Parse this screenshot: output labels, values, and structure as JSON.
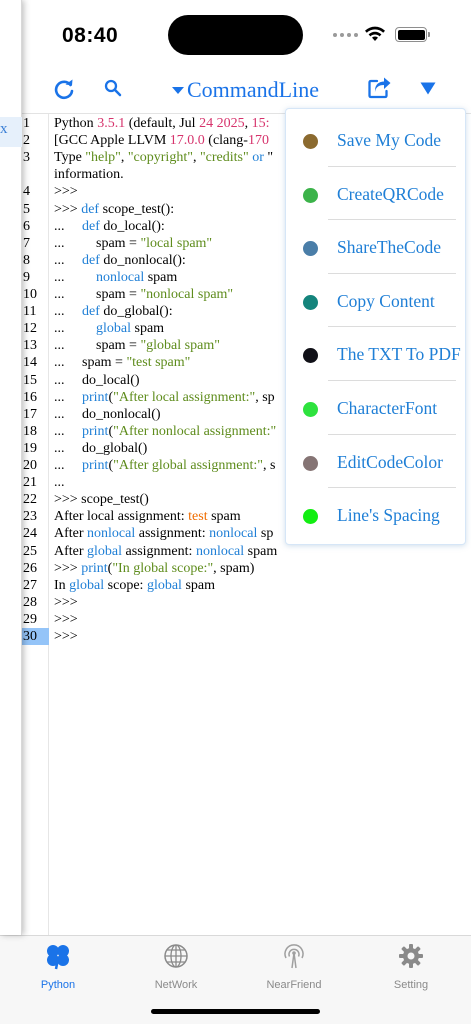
{
  "status": {
    "time": "08:40"
  },
  "side": {
    "cell_text": "x"
  },
  "toolbar": {
    "title": "CommandLine",
    "icons": [
      "refresh-icon",
      "search-icon",
      "share-icon",
      "menu-dropdown-icon"
    ],
    "accent": "#1a73e8"
  },
  "editor": {
    "line_numbers": [
      "1",
      "2",
      "3",
      "",
      "4",
      "5",
      "6",
      "7",
      "8",
      "9",
      "10",
      "11",
      "12",
      "13",
      "14",
      "15",
      "16",
      "17",
      "18",
      "19",
      "20",
      "21",
      "22",
      "23",
      "24",
      "25",
      "26",
      "27",
      "28",
      "29",
      "30"
    ],
    "active_line": "30",
    "lines": [
      [
        {
          "t": "Python "
        },
        {
          "t": "3.5.1",
          "c": "num"
        },
        {
          "t": " (default, Jul "
        },
        {
          "t": "24 2025",
          "c": "num"
        },
        {
          "t": ", "
        },
        {
          "t": "15:",
          "c": "num"
        }
      ],
      [
        {
          "t": "[GCC Apple LLVM "
        },
        {
          "t": "17.0.0",
          "c": "num"
        },
        {
          "t": " (clang-"
        },
        {
          "t": "170",
          "c": "num"
        }
      ],
      [
        {
          "t": "Type "
        },
        {
          "t": "\"help\"",
          "c": "str"
        },
        {
          "t": ", "
        },
        {
          "t": "\"copyright\"",
          "c": "str"
        },
        {
          "t": ", "
        },
        {
          "t": "\"credits\"",
          "c": "str"
        },
        {
          "t": " "
        },
        {
          "t": "or",
          "c": "kw"
        },
        {
          "t": " \""
        }
      ],
      [
        {
          "t": "information."
        }
      ],
      [
        {
          "t": ">>>"
        }
      ],
      [
        {
          "t": ">>> "
        },
        {
          "t": "def",
          "c": "kw"
        },
        {
          "t": " scope_test():"
        }
      ],
      [
        {
          "t": "...     "
        },
        {
          "t": "def",
          "c": "kw"
        },
        {
          "t": " do_local():"
        }
      ],
      [
        {
          "t": "...         spam = "
        },
        {
          "t": "\"local spam\"",
          "c": "str"
        }
      ],
      [
        {
          "t": "...     "
        },
        {
          "t": "def",
          "c": "kw"
        },
        {
          "t": " do_nonlocal():"
        }
      ],
      [
        {
          "t": "...         "
        },
        {
          "t": "nonlocal",
          "c": "kw"
        },
        {
          "t": " spam"
        }
      ],
      [
        {
          "t": "...         spam = "
        },
        {
          "t": "\"nonlocal spam\"",
          "c": "str"
        }
      ],
      [
        {
          "t": "...     "
        },
        {
          "t": "def",
          "c": "kw"
        },
        {
          "t": " do_global():"
        }
      ],
      [
        {
          "t": "...         "
        },
        {
          "t": "global",
          "c": "kw"
        },
        {
          "t": " spam"
        }
      ],
      [
        {
          "t": "...         spam = "
        },
        {
          "t": "\"global spam\"",
          "c": "str"
        }
      ],
      [
        {
          "t": "...     spam = "
        },
        {
          "t": "\"test spam\"",
          "c": "str"
        }
      ],
      [
        {
          "t": "...     do_local()"
        }
      ],
      [
        {
          "t": "...     "
        },
        {
          "t": "print",
          "c": "kw"
        },
        {
          "t": "("
        },
        {
          "t": "\"After local assignment:\"",
          "c": "str"
        },
        {
          "t": ", sp"
        }
      ],
      [
        {
          "t": "...     do_nonlocal()"
        }
      ],
      [
        {
          "t": "...     "
        },
        {
          "t": "print",
          "c": "kw"
        },
        {
          "t": "("
        },
        {
          "t": "\"After nonlocal assignment:\"",
          "c": "str"
        }
      ],
      [
        {
          "t": "...     do_global()"
        }
      ],
      [
        {
          "t": "...     "
        },
        {
          "t": "print",
          "c": "kw"
        },
        {
          "t": "("
        },
        {
          "t": "\"After global assignment:\"",
          "c": "str"
        },
        {
          "t": ", s"
        }
      ],
      [
        {
          "t": "..."
        }
      ],
      [
        {
          "t": ">>> scope_test()"
        }
      ],
      [
        {
          "t": "After local assignment: "
        },
        {
          "t": "test",
          "c": "err"
        },
        {
          "t": " spam"
        }
      ],
      [
        {
          "t": "After "
        },
        {
          "t": "nonlocal",
          "c": "kw"
        },
        {
          "t": " assignment: "
        },
        {
          "t": "nonlocal",
          "c": "kw"
        },
        {
          "t": " sp"
        }
      ],
      [
        {
          "t": "After "
        },
        {
          "t": "global",
          "c": "kw"
        },
        {
          "t": " assignment: "
        },
        {
          "t": "nonlocal",
          "c": "kw"
        },
        {
          "t": " spam"
        }
      ],
      [
        {
          "t": ">>> "
        },
        {
          "t": "print",
          "c": "kw"
        },
        {
          "t": "("
        },
        {
          "t": "\"In global scope:\"",
          "c": "str"
        },
        {
          "t": ", spam)"
        }
      ],
      [
        {
          "t": "In "
        },
        {
          "t": "global",
          "c": "kw"
        },
        {
          "t": " scope: "
        },
        {
          "t": "global",
          "c": "kw"
        },
        {
          "t": " spam"
        }
      ],
      [
        {
          "t": ">>>"
        }
      ],
      [
        {
          "t": ">>>"
        }
      ],
      [
        {
          "t": ">>>"
        }
      ]
    ]
  },
  "menu": {
    "items": [
      {
        "label": "Save My Code",
        "color": "#8b6a2f"
      },
      {
        "label": "CreateQRCode",
        "color": "#3cb34a"
      },
      {
        "label": "ShareTheCode",
        "color": "#4a7ea8"
      },
      {
        "label": "Copy Content",
        "color": "#14847c"
      },
      {
        "label": "The TXT To PDF",
        "color": "#111118"
      },
      {
        "label": "CharacterFont",
        "color": "#2ee23e"
      },
      {
        "label": "EditCodeColor",
        "color": "#857474"
      },
      {
        "label": "Line's Spacing",
        "color": "#12ee12"
      }
    ]
  },
  "tabbar": {
    "tabs": [
      {
        "label": "Python",
        "icon": "python-clover-icon",
        "active": true
      },
      {
        "label": "NetWork",
        "icon": "globe-icon",
        "active": false
      },
      {
        "label": "NearFriend",
        "icon": "antenna-icon",
        "active": false
      },
      {
        "label": "Setting",
        "icon": "gear-icon",
        "active": false
      }
    ]
  }
}
